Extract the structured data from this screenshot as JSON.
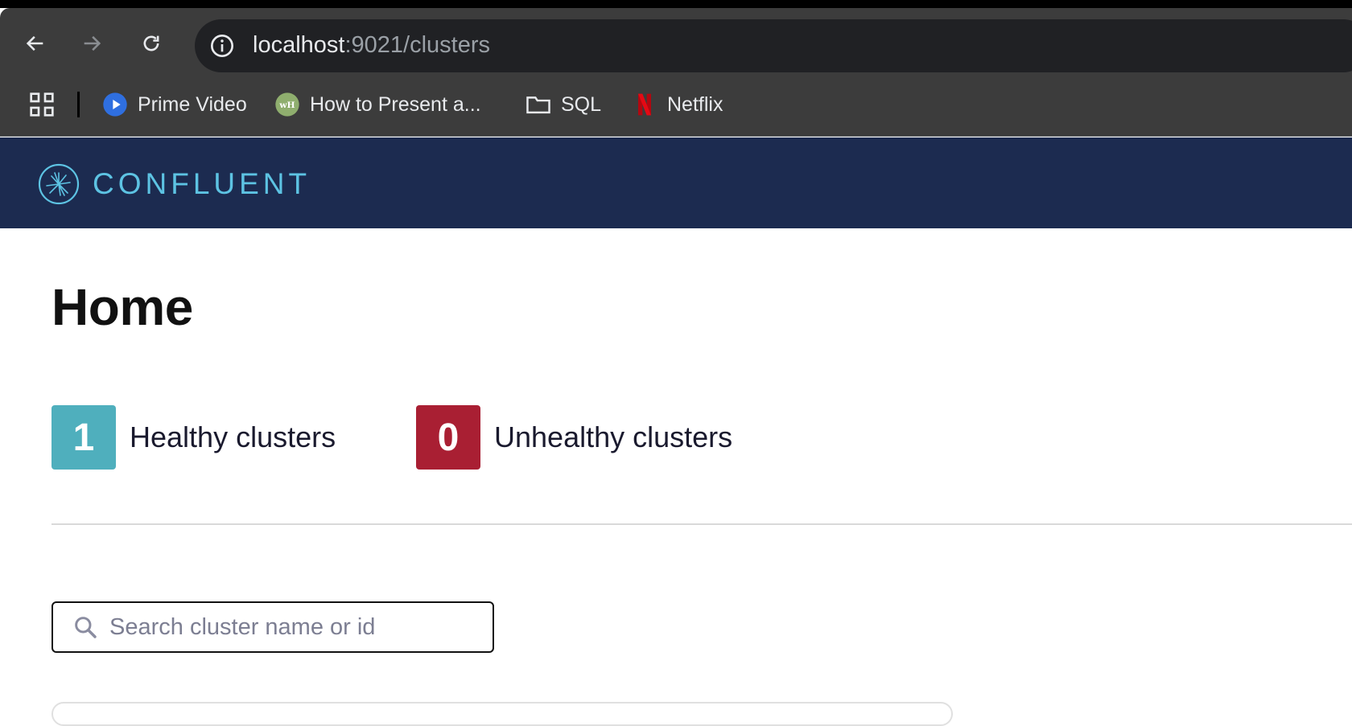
{
  "browser": {
    "url_host": "localhost",
    "url_rest": ":9021/clusters",
    "bookmarks": [
      {
        "label": "Prime Video",
        "icon": "prime-video-icon"
      },
      {
        "label": "How to Present a...",
        "icon": "wh-site-icon"
      },
      {
        "label": "SQL",
        "icon": "folder-icon"
      },
      {
        "label": "Netflix",
        "icon": "netflix-icon"
      }
    ]
  },
  "header": {
    "logo_text": "CONFLUENT"
  },
  "main": {
    "title": "Home",
    "healthy": {
      "count": "1",
      "label": "Healthy clusters",
      "color": "#4fafbd"
    },
    "unhealthy": {
      "count": "0",
      "label": "Unhealthy clusters",
      "color": "#a91f33"
    },
    "search": {
      "placeholder": "Search cluster name or id",
      "value": ""
    }
  }
}
